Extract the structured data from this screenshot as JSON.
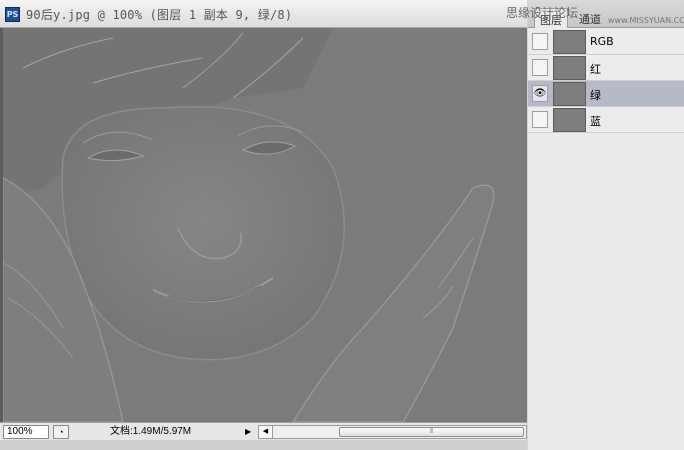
{
  "document": {
    "app_icon": "PS",
    "title": "90后y.jpg @ 100% (图层 1 副本 9, 绿/8)"
  },
  "status": {
    "zoom": "100%",
    "doc_info": "文档:1.49M/5.97M",
    "preview_icon": "◔",
    "arrow": "▶",
    "scroll_left": "◀",
    "thumb_grip": "⦀"
  },
  "panel": {
    "tabs": [
      "图层",
      "通道"
    ],
    "watermark": "思缘设计论坛",
    "watermark_url": "www.MISSYUAN.COM",
    "channels": [
      {
        "label": "RGB",
        "visible": false,
        "selected": false
      },
      {
        "label": "红",
        "visible": false,
        "selected": false
      },
      {
        "label": "绿",
        "visible": true,
        "selected": true
      },
      {
        "label": "蓝",
        "visible": false,
        "selected": false
      }
    ],
    "eye_glyph": "👁"
  },
  "colors": {
    "canvas_gray": "#7c7c7c",
    "selected_row": "#b6b9c8"
  }
}
